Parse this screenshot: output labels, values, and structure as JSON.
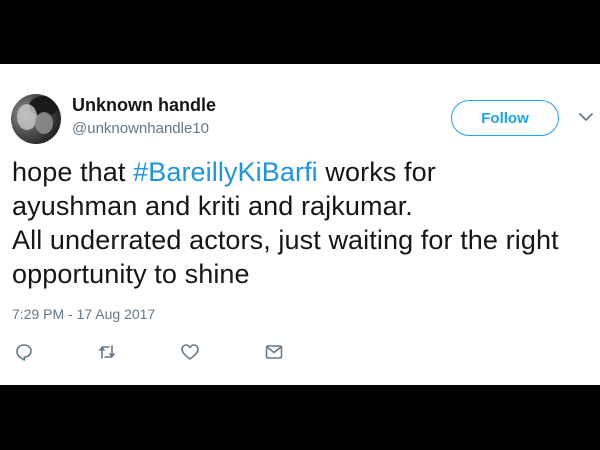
{
  "user": {
    "display_name": "Unknown handle",
    "handle": "@unknownhandle10"
  },
  "follow_label": "Follow",
  "tweet": {
    "line1_prefix": "hope that ",
    "hashtag": "#BareillyKiBarfi",
    "line1_suffix": " works for",
    "line2": "ayushman and kriti and rajkumar.",
    "line3": "All underrated actors, just waiting for the right",
    "line4": "opportunity to shine"
  },
  "timestamp": "7:29 PM - 17 Aug 2017",
  "colors": {
    "accent": "#1da1f2",
    "hashtag": "#1b95e0",
    "text": "#14171a",
    "secondary": "#657786"
  },
  "icons": [
    "reply-icon",
    "retweet-icon",
    "like-icon",
    "direct-message-icon",
    "chevron-down-icon"
  ]
}
